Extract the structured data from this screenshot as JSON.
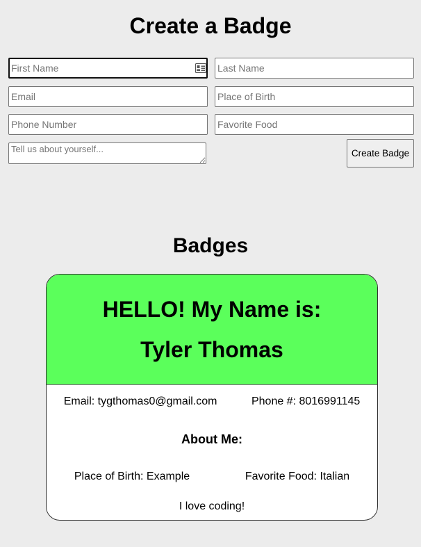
{
  "page": {
    "title": "Create a Badge"
  },
  "form": {
    "first_name": {
      "placeholder": "First Name",
      "value": ""
    },
    "last_name": {
      "placeholder": "Last Name",
      "value": ""
    },
    "email": {
      "placeholder": "Email",
      "value": ""
    },
    "place_of_birth": {
      "placeholder": "Place of Birth",
      "value": ""
    },
    "phone": {
      "placeholder": "Phone Number",
      "value": ""
    },
    "favorite_food": {
      "placeholder": "Favorite Food",
      "value": ""
    },
    "about": {
      "placeholder": "Tell us about yourself...",
      "value": ""
    },
    "submit_label": "Create Badge",
    "autofill_icon": "contact-card-icon"
  },
  "badges": {
    "section_title": "Badges",
    "items": [
      {
        "hello": "HELLO! My Name is:",
        "name": "Tyler Thomas",
        "email_text": "Email: tygthomas0@gmail.com",
        "phone_text": "Phone #: 8016991145",
        "about_heading": "About Me:",
        "place_of_birth_text": "Place of Birth: Example",
        "favorite_food_text": "Favorite Food: Italian",
        "about_text": "I love coding!"
      }
    ]
  },
  "colors": {
    "page_background": "#ececec",
    "badge_header": "#5bff5b",
    "badge_body": "#ffffff"
  }
}
